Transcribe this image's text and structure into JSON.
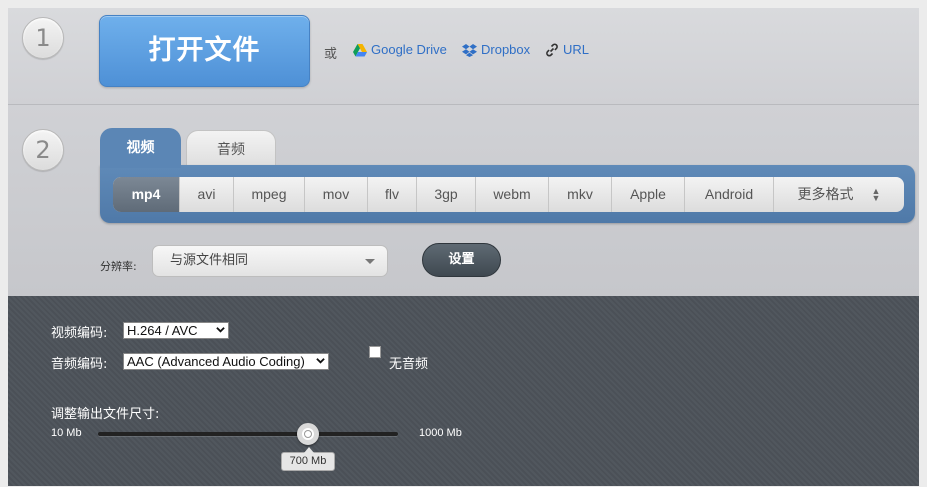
{
  "step1": {
    "number": "1",
    "open_file_label": "打开文件",
    "or_text": "或",
    "links": [
      {
        "label": "Google Drive",
        "icon": "google-drive-icon"
      },
      {
        "label": "Dropbox",
        "icon": "dropbox-icon"
      },
      {
        "label": "URL",
        "icon": "link-icon"
      }
    ]
  },
  "step2": {
    "number": "2",
    "tabs": [
      {
        "label": "视频",
        "active": true
      },
      {
        "label": "音频",
        "active": false
      }
    ],
    "formats": [
      "mp4",
      "avi",
      "mpeg",
      "mov",
      "flv",
      "3gp",
      "webm",
      "mkv",
      "Apple",
      "Android",
      "更多格式"
    ],
    "active_format": "mp4",
    "resolution_label": "分辨率:",
    "resolution_value": "与源文件相同",
    "settings_label": "设置"
  },
  "settings": {
    "video_codec_label": "视频编码:",
    "video_codec_value": "H.264 / AVC",
    "audio_codec_label": "音频编码:",
    "audio_codec_value": "AAC (Advanced Audio Coding)",
    "no_audio_label": "无音频",
    "no_audio_checked": false,
    "size_label": "调整输出文件尺寸:",
    "slider_min": "10 Mb",
    "slider_max": "1000 Mb",
    "slider_value": "700 Mb",
    "slider_fraction": 0.7
  },
  "colors": {
    "accent_blue": "#5b86b5",
    "open_button": "#5a9de0",
    "dark_panel": "#4d535a",
    "link": "#2f6fc6"
  }
}
